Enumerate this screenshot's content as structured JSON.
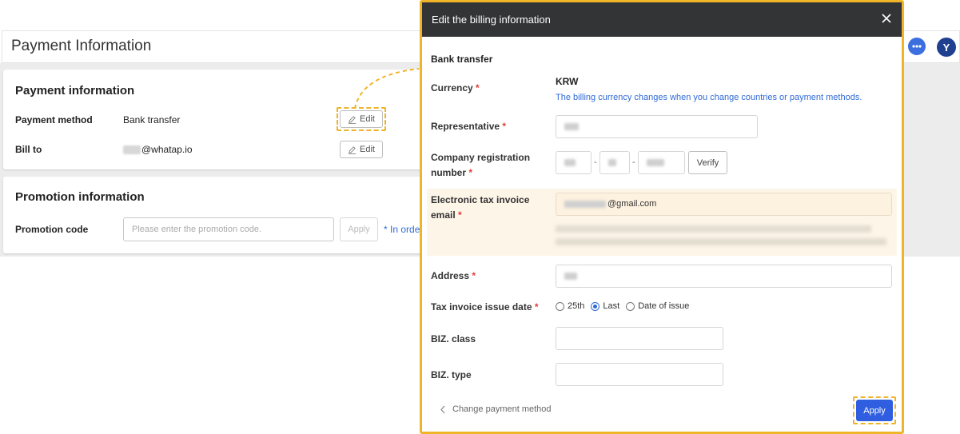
{
  "page": {
    "title": "Payment Information"
  },
  "payment_card": {
    "heading": "Payment information",
    "method_label": "Payment method",
    "method_value": "Bank transfer",
    "bill_to_label": "Bill to",
    "bill_to_value": "@whatap.io",
    "edit_label": "Edit"
  },
  "promotion_card": {
    "heading": "Promotion information",
    "code_label": "Promotion code",
    "code_placeholder": "Please enter the promotion code.",
    "apply_label": "Apply",
    "note": "* In orde"
  },
  "header_icons": {
    "chat": "chat-bubble-icon",
    "avatar_letter": "Y"
  },
  "modal": {
    "title": "Edit the billing information",
    "section": "Bank transfer",
    "currency_label": "Currency",
    "currency_value": "KRW",
    "currency_note": "The billing currency changes when you change countries or payment methods.",
    "representative_label": "Representative",
    "company_reg_label_1": "Company registration",
    "company_reg_label_2": "number",
    "verify_label": "Verify",
    "email_label_1": "Electronic tax invoice",
    "email_label_2": "email",
    "email_value": "@gmail.com",
    "address_label": "Address",
    "issue_date_label": "Tax invoice issue date",
    "issue_options": [
      "25th",
      "Last",
      "Date of issue"
    ],
    "issue_selected": "Last",
    "biz_class_label": "BIZ. class",
    "biz_type_label": "BIZ. type",
    "back_label": "Change payment method",
    "apply_label": "Apply",
    "required_mark": "*",
    "highlight_color": "#f0b429",
    "primary_color": "#2f5fe0"
  }
}
